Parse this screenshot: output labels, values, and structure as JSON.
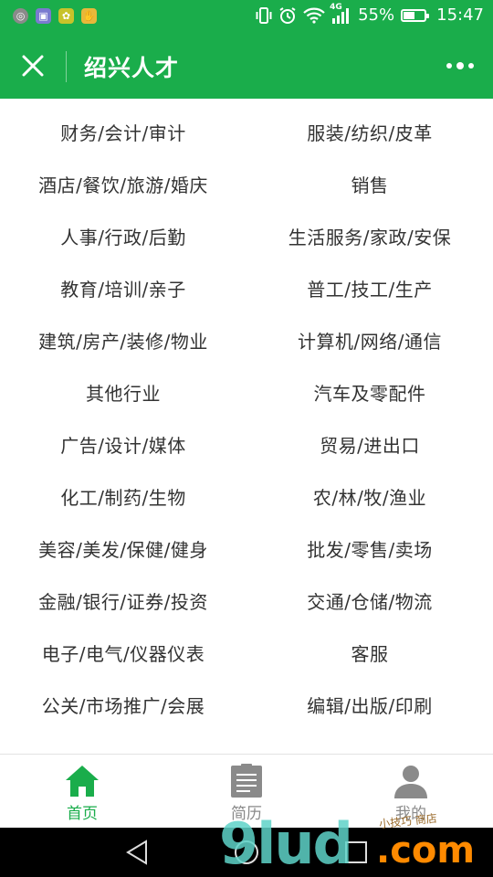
{
  "status_bar": {
    "network": "4G",
    "battery_percent": "55%",
    "battery_level": 0.55,
    "time": "15:47"
  },
  "title_bar": {
    "title": "绍兴人才"
  },
  "categories": [
    "财务/会计/审计",
    "服装/纺织/皮革",
    "酒店/餐饮/旅游/婚庆",
    "销售",
    "人事/行政/后勤",
    "生活服务/家政/安保",
    "教育/培训/亲子",
    "普工/技工/生产",
    "建筑/房产/装修/物业",
    "计算机/网络/通信",
    "其他行业",
    "汽车及零配件",
    "广告/设计/媒体",
    "贸易/进出口",
    "化工/制药/生物",
    "农/林/牧/渔业",
    "美容/美发/保健/健身",
    "批发/零售/卖场",
    "金融/银行/证券/投资",
    "交通/仓储/物流",
    "电子/电气/仪器仪表",
    "客服",
    "公关/市场推广/会展",
    "编辑/出版/印刷"
  ],
  "tabs": [
    {
      "label": "首页",
      "icon": "home-icon",
      "active": true
    },
    {
      "label": "简历",
      "icon": "clipboard-icon",
      "active": false
    },
    {
      "label": "我的",
      "icon": "person-icon",
      "active": false
    }
  ],
  "colors": {
    "brand": "#1aad4b",
    "tab_active": "#1aad4b",
    "tab_inactive": "#8a8a8a",
    "text": "#333333"
  },
  "watermark": {
    "main": "9lud",
    "suffix": ".com",
    "small": "小技巧 商店"
  }
}
